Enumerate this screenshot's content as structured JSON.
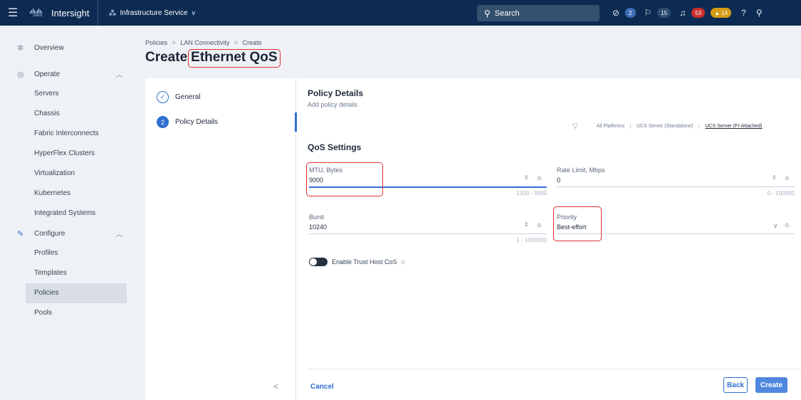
{
  "topbar": {
    "logo_word": "cisco",
    "app_name": "Intersight",
    "service": "Infrastructure Service",
    "search_label": "Search",
    "badges": {
      "requests": "2",
      "announcements": "15",
      "alerts_critical": "53",
      "alerts_warning": "14"
    }
  },
  "sidebar": {
    "overview": "Overview",
    "operate": {
      "label": "Operate",
      "items": [
        "Servers",
        "Chassis",
        "Fabric Interconnects",
        "HyperFlex Clusters",
        "Virtualization",
        "Kubernetes",
        "Integrated Systems"
      ]
    },
    "configure": {
      "label": "Configure",
      "items": [
        "Profiles",
        "Templates",
        "Policies",
        "Pools"
      ],
      "active": "Policies"
    }
  },
  "breadcrumb": {
    "items": [
      "Policies",
      "LAN Connectivity",
      "Create"
    ]
  },
  "page": {
    "title_prefix": "Create",
    "title_highlight": "Ethernet QoS"
  },
  "steps": [
    {
      "label": "General",
      "state": "done",
      "marker": "✓"
    },
    {
      "label": "Policy Details",
      "state": "current",
      "marker": "2"
    }
  ],
  "policy_details": {
    "title": "Policy Details",
    "subtitle": "Add policy details",
    "platforms": [
      "All Platforms",
      "UCS Server (Standalone)",
      "UCS Server (FI-Attached)"
    ],
    "selected_platform": "UCS Server (FI-Attached)"
  },
  "qos": {
    "title": "QoS Settings",
    "mtu": {
      "label": "MTU, Bytes",
      "value": "9000",
      "hint": "1500 - 9000"
    },
    "rate_limit": {
      "label": "Rate Limit, Mbps",
      "value": "0",
      "hint": "0 - 100000"
    },
    "burst": {
      "label": "Burst",
      "value": "10240",
      "hint": "1 - 1000000"
    },
    "priority": {
      "label": "Priority",
      "value": "Best-effort"
    },
    "trust_host_cos": {
      "label": "Enable Trust Host CoS",
      "enabled": false
    }
  },
  "footer": {
    "cancel": "Cancel",
    "back": "Back",
    "create": "Create"
  },
  "colors": {
    "topbar": "#0d2b52",
    "accent": "#2f6fd0",
    "highlight": "#e03030",
    "create_button": "#4f87de"
  }
}
